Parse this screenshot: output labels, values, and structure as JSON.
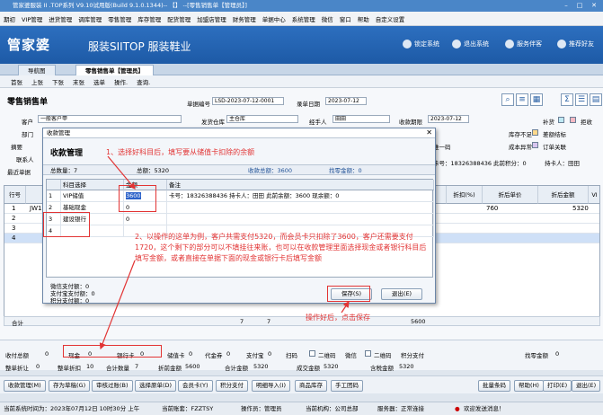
{
  "titlebar": {
    "text": "管家婆服装 II .TOP系列 V9.10试用版(Build 9.1.0.1344)-- 【】 --[零售销售单【管理员】]"
  },
  "menu": [
    "期初",
    "VIP管理",
    "进货管理",
    "调库管理",
    "零售管理",
    "库存管理",
    "配货管理",
    "加盟店管理",
    "财务管理",
    "单据中心",
    "系统管理",
    "微信",
    "窗口",
    "帮助",
    "自定义设置"
  ],
  "banner": {
    "logo_cn": "管家婆",
    "logo_en": "服装SIITOP 服装鞋业",
    "btn_lock": "锁定系统",
    "btn_exit": "退出系统",
    "btn_service": "服务伴客",
    "btn_recommend": "推荐好友"
  },
  "tabs": [
    "导航图",
    "零售销售单【管理员】"
  ],
  "toolbar": [
    "首张",
    "上张",
    "下张",
    "末张",
    "选单",
    "操作.",
    "查询."
  ],
  "page": {
    "title": "零售销售单",
    "bill_no_label": "单据编号",
    "bill_no": "LSD-2023-07-12-0001",
    "record_date_label": "录单日期",
    "record_date": "2023-07-12",
    "customer_label": "客户",
    "customer": "一般客户甲",
    "store_label": "发货仓库",
    "store": "主仓库",
    "handler_label": "经手人",
    "handler": "田田",
    "receive_date_label": "收款期限",
    "receive_date": "2023-07-12",
    "dept_label": "部门",
    "summary_label": "摘要",
    "contact_label": "联系人",
    "recent_label": "最近单据",
    "fill_label": "补货",
    "reject_label": "拒收",
    "stock_short_label": "库存不足",
    "price_warn_label": "差额结标",
    "cost_label": "成本异常",
    "order_rel_label": "订单关联",
    "scan_label": "推一码",
    "card_info": "卡号：18326388436  此前积分：0",
    "card_holder": "持卡人：田田"
  },
  "grid": {
    "headers": [
      "行号",
      "",
      "折扣(%)",
      "折后单价",
      "折后金额",
      "VI"
    ],
    "row1": {
      "no": "1",
      "code": "JW1",
      "discount_price": "760",
      "amount": "5320"
    },
    "rows_extra": [
      "2",
      "3",
      "4"
    ],
    "sum_label": "合计",
    "sum_qty1": "7",
    "sum_qty2": "7",
    "sum_amount": "5600"
  },
  "dialog": {
    "title": "收款管理",
    "heading": "收款管理",
    "total_qty": "总数量：7",
    "total_amount": "总额：5320",
    "collected": "收款总额：3600",
    "change": "找零金额：0",
    "headers": [
      "",
      "科目选择",
      "金额",
      "备注"
    ],
    "rows": [
      {
        "no": "1",
        "subject": "VIP储值",
        "amount": "3600",
        "memo": "卡号：18326388436  持卡人：田田  此前余额：3600  现余额：0"
      },
      {
        "no": "2",
        "subject": "基础现金",
        "amount": "0",
        "memo": ""
      },
      {
        "no": "3",
        "subject": "建设银行",
        "amount": "0",
        "memo": ""
      },
      {
        "no": "4",
        "subject": "",
        "amount": "",
        "memo": ""
      }
    ],
    "wechat_paid": "微信支付额：0",
    "alipay_paid": "支付宝支付额：0",
    "points_paid": "积分支付额：0",
    "save_btn": "保存(S)",
    "exit_btn": "退出(E)"
  },
  "annotations": {
    "note1": "1、选择好科目后，填写要从储值卡扣除的余额",
    "note2": "2、以操作的这单为例，客户共需支付5320，而会员卡只扣除了3600，客户还需要支付1720，这个剩下的部分可以不填挂往来账，也可以在收款管理里面选择现金或者银行科目后填写金额，或者直接在单据下面的现金或银行卡后填写金额",
    "note3": "操作好后，点击保存"
  },
  "payrow": {
    "received_label": "收付总额",
    "received": "0",
    "cash_label": "现金",
    "cash": "0",
    "bankcard_label": "银行卡",
    "bankcard": "0",
    "storedcard_label": "储值卡",
    "storedcard": "0",
    "coupon_label": "代金券",
    "coupon": "0",
    "alipay_label": "支付宝",
    "alipay": "0",
    "scan_label": "扫码",
    "qr_label": "二维码",
    "wechat_label": "微信",
    "points_pay_label": "积分支付",
    "change_label": "找零金额",
    "change": "0",
    "whole_discount_label": "整单折让",
    "whole_discount": "0",
    "whole_rate_label": "整单折扣",
    "whole_rate": "10",
    "total_qty_label": "合计数量",
    "total_qty": "7",
    "disc_amount_label": "折前金额",
    "disc_amount": "5600",
    "total_amount_label": "合计金额",
    "total_amount": "5320",
    "deal_amount_label": "成交金额",
    "deal_amount": "5320",
    "tax_label": "含税金额",
    "tax_amount": "5320"
  },
  "buttons": [
    "收款管理(M)",
    "存为草稿(G)",
    "审核过账(B)",
    "选择原单(D)",
    "会员卡(Y)",
    "积分支付",
    "明细导入(I)",
    "商品库存",
    "手工团码"
  ],
  "buttons_right": [
    "批量条码",
    "帮助(H)",
    "打印(E)",
    "退出(E)"
  ],
  "status": {
    "time": "当前系统时间为：2023年07月12日 10时30分 上午",
    "account": "当前账套：FZZTSY",
    "operator": "操作员：管理员",
    "org": "当前机构：公司总部",
    "server": "服务器：正常连接",
    "sms": "欢迎发送消息！"
  },
  "colors": {
    "accent": "#2d6fbf",
    "annotation": "#e23434"
  }
}
